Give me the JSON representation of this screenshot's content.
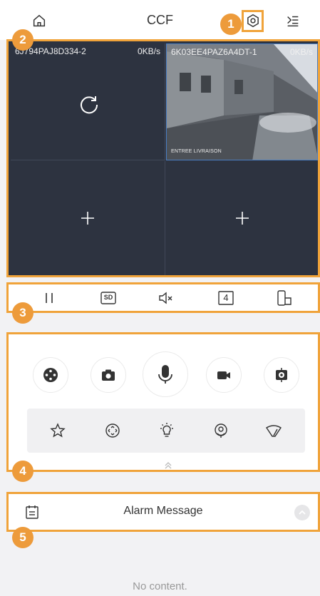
{
  "header": {
    "title": "CCF",
    "icons": {
      "home": "home-icon",
      "settings": "settings-icon",
      "menu": "menu-icon"
    }
  },
  "badges": [
    "1",
    "2",
    "3",
    "4",
    "5"
  ],
  "video": {
    "cells": [
      {
        "label": "6J794PAJ8D334-2",
        "rate": "0KB/s"
      },
      {
        "label": "6K03EE4PAZ6A4DT-1",
        "rate": "0KB/s",
        "overlay": "ENTREE LIVRAISON"
      },
      {
        "label": ""
      },
      {
        "label": ""
      }
    ]
  },
  "controls": {
    "sd_label": "SD",
    "split_label": "4"
  },
  "alarm": {
    "title": "Alarm Message",
    "empty_text": "No content."
  },
  "colors": {
    "highlight": "#f0a33a",
    "badge": "#ed9b3b",
    "video_bg": "#2d3340"
  }
}
